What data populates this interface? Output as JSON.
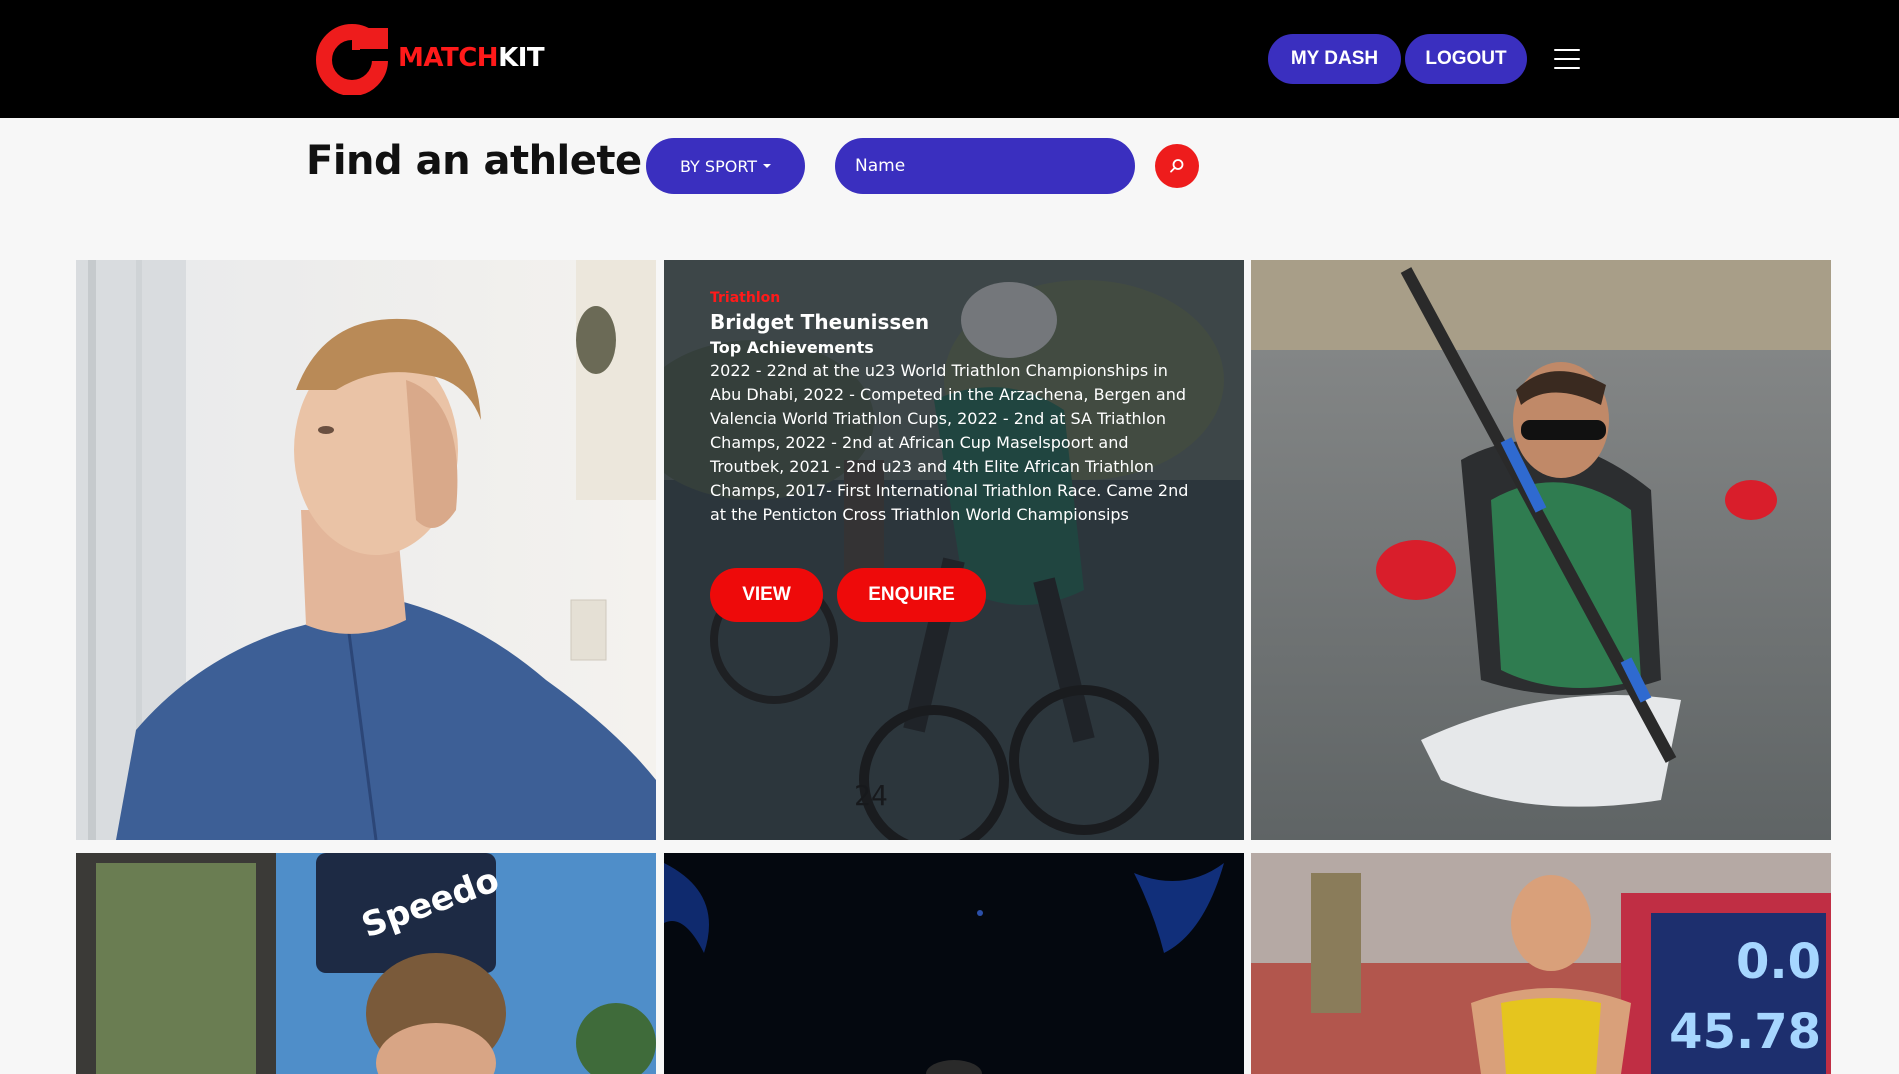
{
  "brand": {
    "name_part1": "MATCH",
    "name_part2": "KIT",
    "icon": "matchkit-logo",
    "accent": "#ff1a1a"
  },
  "nav": {
    "dash_label": "MY DASH",
    "logout_label": "LOGOUT",
    "menu_icon": "hamburger-icon"
  },
  "search": {
    "title": "Find an athlete",
    "filter_label": "BY SPORT",
    "name_placeholder": "Name",
    "search_icon": "search-icon"
  },
  "colors": {
    "primary": "#3a2fbf",
    "danger": "#ee0a0a",
    "header_bg": "#000000",
    "page_bg": "#f7f7f7"
  },
  "featured": {
    "sport": "Triathlon",
    "name": "Bridget Theunissen",
    "achievements_title": "Top Achievements",
    "achievements_text": "2022 - 22nd at the u23 World Triathlon Championships in Abu Dhabi, 2022 - Competed in the Arzachena, Bergen and Valencia World Triathlon Cups, 2022 - 2nd at SA Triathlon Champs, 2022 - 2nd at African Cup Maselspoort and Troutbek, 2021 - 2nd u23 and 4th Elite African Triathlon Champs, 2017- First International Triathlon Race. Came 2nd at the Penticton Cross Triathlon World Championsips",
    "view_label": "VIEW",
    "enquire_label": "ENQUIRE"
  },
  "card_texts": {
    "speedo_banner": "Speedo",
    "scoreboard_1": "0.0",
    "scoreboard_2": "45.78",
    "bike_number": "24"
  }
}
